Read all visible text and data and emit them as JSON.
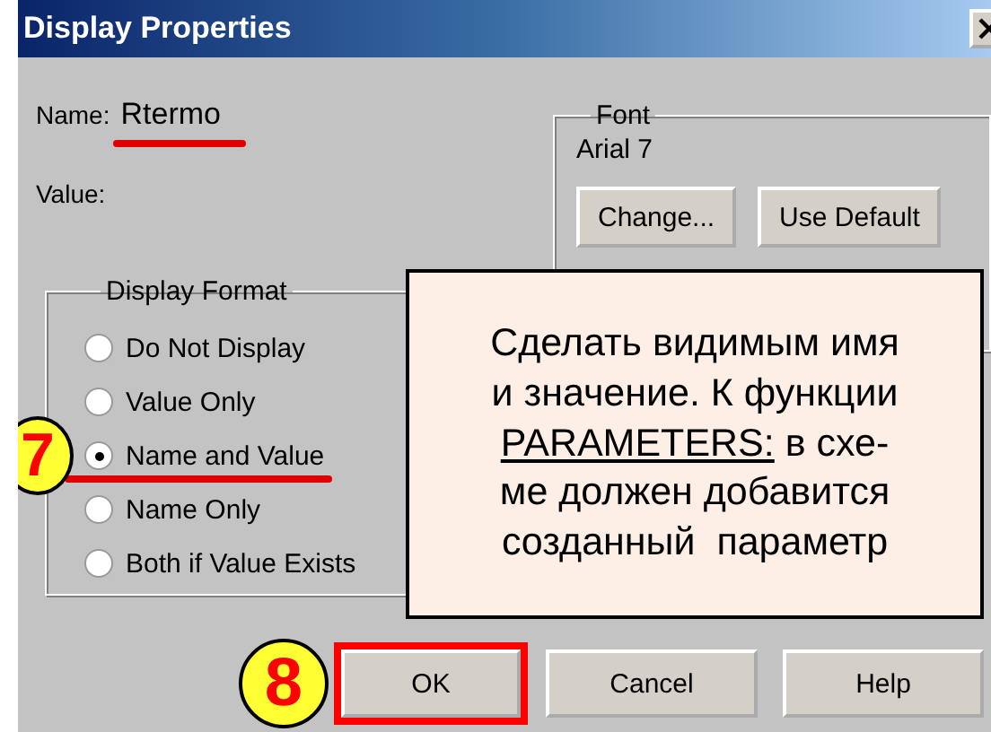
{
  "window": {
    "title": "Display Properties"
  },
  "name": {
    "label": "Name:",
    "value": "Rtermo",
    "underlined": true
  },
  "value": {
    "label": "Value:"
  },
  "display_format": {
    "title": "Display Format",
    "options": [
      {
        "label": "Do Not Display",
        "selected": false
      },
      {
        "label": "Value Only",
        "selected": false
      },
      {
        "label": "Name and Value",
        "selected": true,
        "underlined": true,
        "badge": "7"
      },
      {
        "label": "Name Only",
        "selected": false
      },
      {
        "label": "Both if Value Exists",
        "selected": false
      }
    ]
  },
  "font": {
    "title": "Font",
    "current": "Arial 7",
    "buttons": [
      "Change...",
      "Use Default"
    ]
  },
  "callout": {
    "lines": [
      {
        "text": "Сделать видимым имя"
      },
      {
        "text": "и значение. К функции"
      },
      {
        "underlined": "PARAMETERS:",
        "text": " в схе-"
      },
      {
        "text": "ме должен добавится"
      },
      {
        "text": "созданный  параметр"
      }
    ]
  },
  "buttons": [
    {
      "label": "OK",
      "highlighted": true,
      "badge": "8"
    },
    {
      "label": "Cancel",
      "highlighted": false
    },
    {
      "label": "Help",
      "highlighted": false
    }
  ]
}
